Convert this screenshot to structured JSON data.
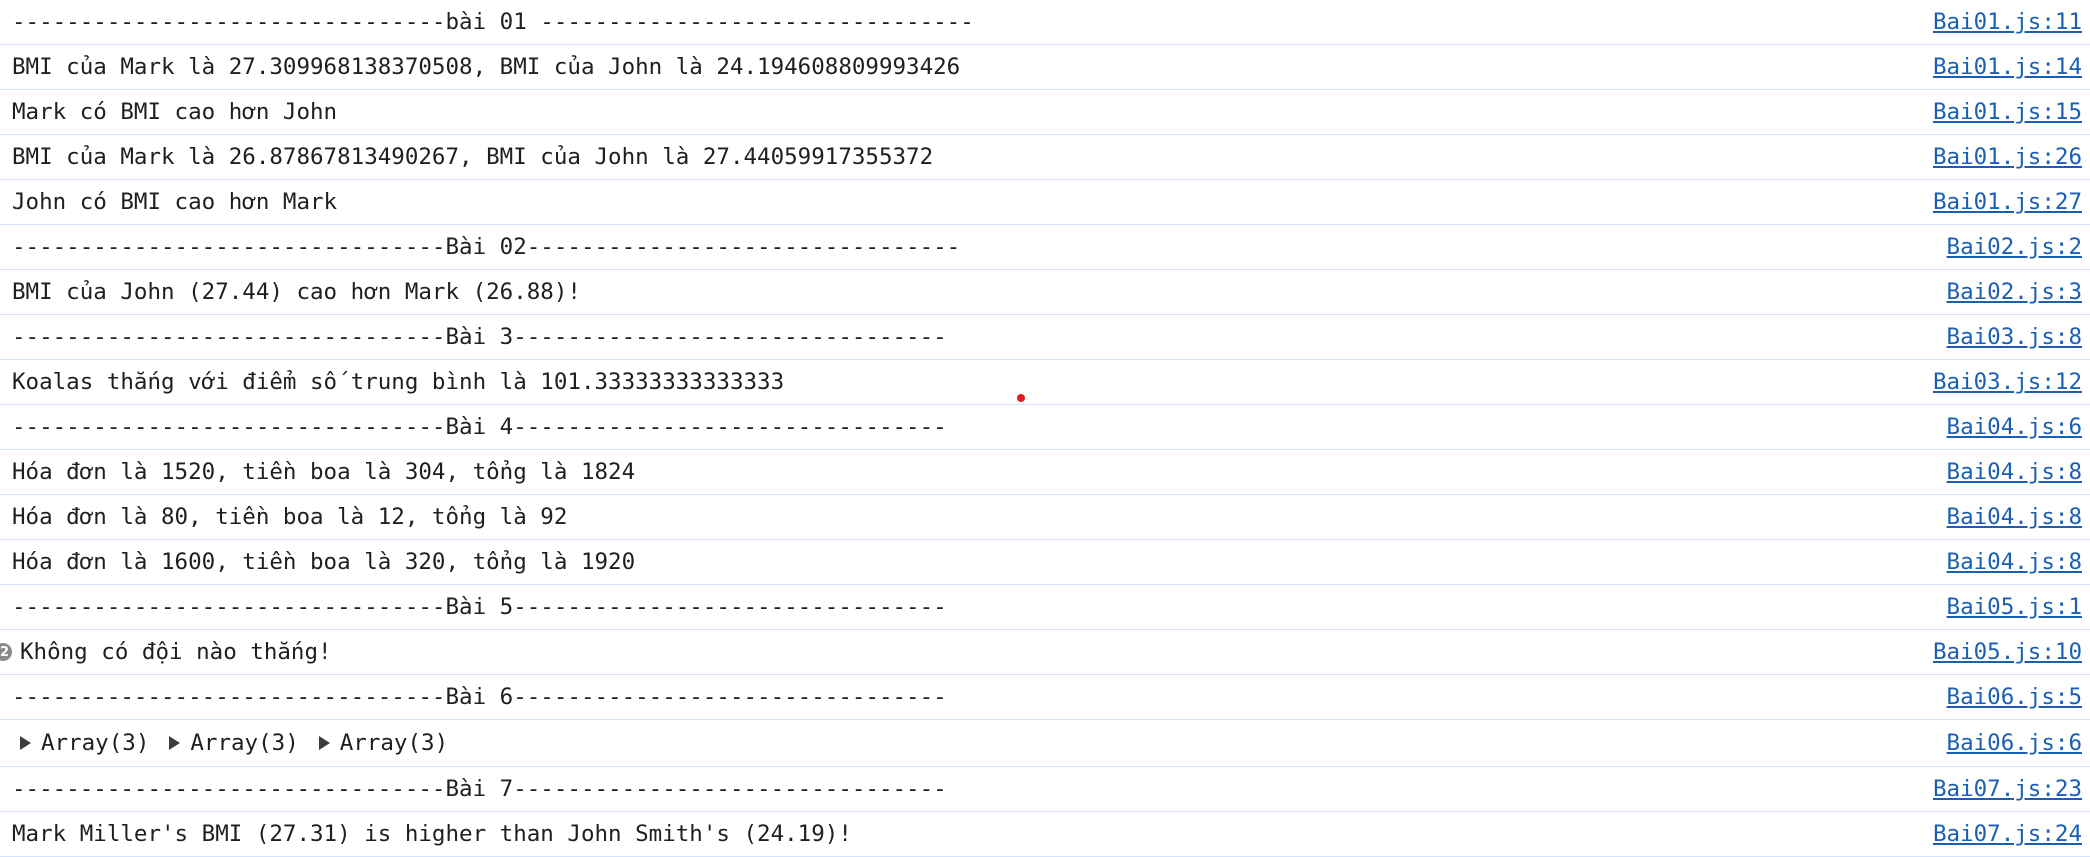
{
  "console": {
    "rows": [
      {
        "message": "--------------------------------bài 01 --------------------------------",
        "source": "Bai01.js:11"
      },
      {
        "message": "BMI của Mark là 27.309968138370508, BMI của John là 24.194608809993426",
        "source": "Bai01.js:14"
      },
      {
        "message": "Mark có BMI cao hơn John",
        "source": "Bai01.js:15"
      },
      {
        "message": "BMI của Mark là 26.87867813490267, BMI của John là 27.44059917355372",
        "source": "Bai01.js:26"
      },
      {
        "message": "John có BMI cao hơn Mark",
        "source": "Bai01.js:27"
      },
      {
        "message": "--------------------------------Bài 02--------------------------------",
        "source": "Bai02.js:2"
      },
      {
        "message": "BMI của John (27.44) cao hơn Mark (26.88)!",
        "source": "Bai02.js:3"
      },
      {
        "message": "--------------------------------Bài 3--------------------------------",
        "source": "Bai03.js:8"
      },
      {
        "message": "Koalas thắng với điểm số trung bình là 101.33333333333333",
        "source": "Bai03.js:12"
      },
      {
        "message": "--------------------------------Bài 4--------------------------------",
        "source": "Bai04.js:6"
      },
      {
        "message": "Hóa đơn là 1520, tiền boa là 304, tổng là 1824",
        "source": "Bai04.js:8"
      },
      {
        "message": "Hóa đơn là 80, tiền boa là 12, tổng là 92",
        "source": "Bai04.js:8"
      },
      {
        "message": "Hóa đơn là 1600, tiền boa là 320, tổng là 1920",
        "source": "Bai04.js:8"
      },
      {
        "message": "--------------------------------Bài 5--------------------------------",
        "source": "Bai05.js:1"
      }
    ],
    "repeat_row": {
      "count": "2",
      "message": "Không có đội nào thắng!",
      "source": "Bai05.js:10"
    },
    "bai6_header": {
      "message": "--------------------------------Bài 6--------------------------------",
      "source": "Bai06.js:5"
    },
    "array_row": {
      "items": [
        "Array(3)",
        "Array(3)",
        "Array(3)"
      ],
      "source": "Bai06.js:6"
    },
    "tail_rows": [
      {
        "message": "--------------------------------Bài 7--------------------------------",
        "source": "Bai07.js:23"
      },
      {
        "message": "Mark Miller's BMI (27.31) is higher than John Smith's (24.19)!",
        "source": "Bai07.js:24"
      }
    ]
  },
  "colors": {
    "link": "#1a5fb4",
    "separator": "#d3e3fd",
    "badge": "#8a8a8a"
  }
}
